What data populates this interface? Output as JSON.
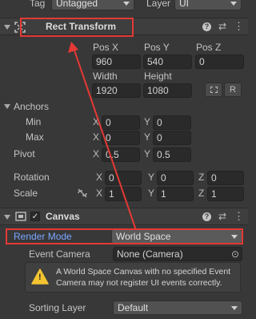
{
  "top": {
    "tag_label": "Tag",
    "tag_value": "Untagged",
    "layer_label": "Layer",
    "layer_value": "UI"
  },
  "rect_transform": {
    "title": "Rect Transform",
    "pos_x_label": "Pos X",
    "pos_y_label": "Pos Y",
    "pos_z_label": "Pos Z",
    "pos_x": "960",
    "pos_y": "540",
    "pos_z": "0",
    "width_label": "Width",
    "height_label": "Height",
    "width": "1920",
    "height": "1080",
    "raw_edit_label": "R",
    "anchors_label": "Anchors",
    "min_label": "Min",
    "max_label": "Max",
    "min_x": "0",
    "min_y": "0",
    "max_x": "0",
    "max_y": "0",
    "pivot_label": "Pivot",
    "pivot_x": "0.5",
    "pivot_y": "0.5",
    "rotation_label": "Rotation",
    "rot_x": "0",
    "rot_y": "0",
    "rot_z": "0",
    "scale_label": "Scale",
    "scale_x": "1",
    "scale_y": "1",
    "scale_z": "1",
    "axis_x": "X",
    "axis_y": "Y",
    "axis_z": "Z"
  },
  "canvas": {
    "title": "Canvas",
    "render_mode_label": "Render Mode",
    "render_mode_value": "World Space",
    "event_camera_label": "Event Camera",
    "event_camera_value": "None (Camera)",
    "warning_text": "A World Space Canvas with no specified Event Camera may not register UI events correctly.",
    "sorting_layer_label": "Sorting Layer",
    "sorting_layer_value": "Default"
  },
  "icons": {
    "help": "question-circle-icon",
    "presets": "sliders-icon",
    "menu": "kebab-menu-icon",
    "help_glyph": "?",
    "presets_glyph": "⇄",
    "menu_glyph": "⋮",
    "warning_glyph": "!",
    "target_glyph": "⊙"
  },
  "colors": {
    "highlight_red": "#e53935",
    "label_blue": "#7aa6ff",
    "warning_yellow": "#f4c430"
  }
}
